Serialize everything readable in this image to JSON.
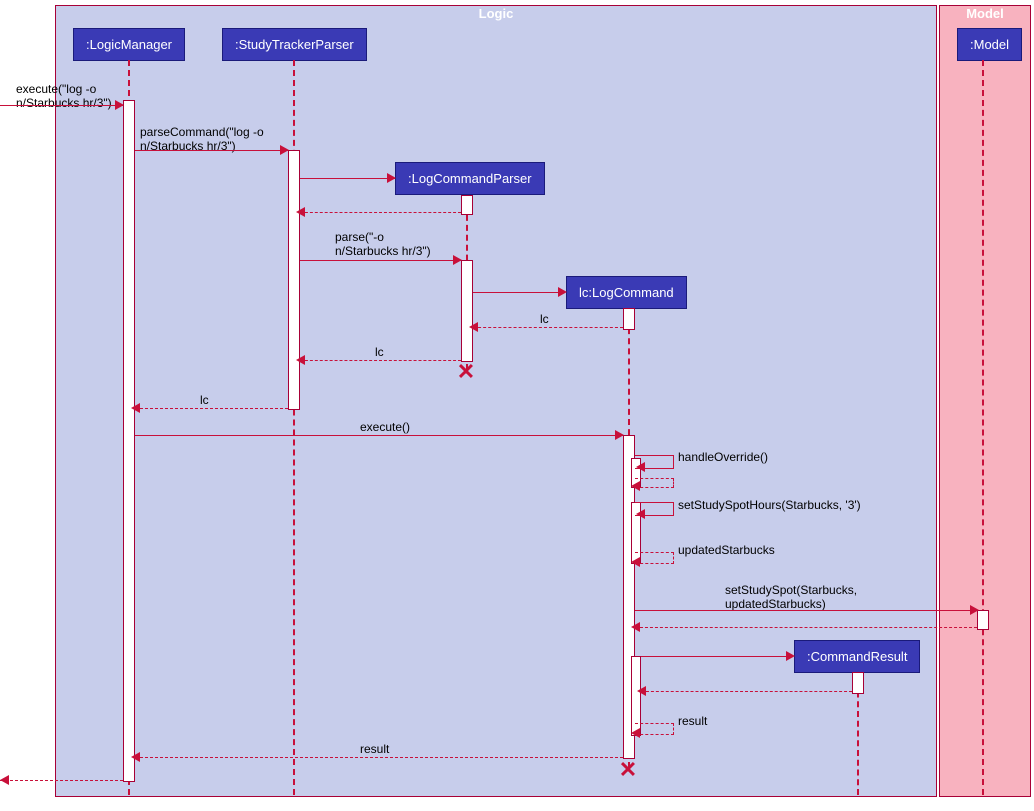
{
  "frames": {
    "logic": "Logic",
    "model": "Model"
  },
  "participants": {
    "logicManager": ":LogicManager",
    "studyTrackerParser": ":StudyTrackerParser",
    "logCommandParser": ":LogCommandParser",
    "logCommand": "lc:LogCommand",
    "commandResult": ":CommandResult",
    "model": ":Model"
  },
  "messages": {
    "execute1": "execute(\"log -o\nn/Starbucks hr/3\")",
    "parseCommand": "parseCommand(\"log -o\nn/Starbucks hr/3\")",
    "parse": "parse(\"-o\nn/Starbucks hr/3\")",
    "lc1": "lc",
    "lc2": "lc",
    "lc3": "lc",
    "execute2": "execute()",
    "handleOverride": "handleOverride()",
    "setStudySpotHours": "setStudySpotHours(Starbucks, '3')",
    "updatedStarbucks": "updatedStarbucks",
    "setStudySpot": "setStudySpot(Starbucks,\nupdatedStarbucks)",
    "result1": "result",
    "result2": "result"
  },
  "chart_data": {
    "type": "sequence-diagram",
    "frames": [
      {
        "name": "Logic",
        "participants": [
          "LogicManager",
          "StudyTrackerParser",
          "LogCommandParser",
          "lc:LogCommand",
          "CommandResult"
        ]
      },
      {
        "name": "Model",
        "participants": [
          "Model"
        ]
      }
    ],
    "participants": [
      {
        "id": "caller",
        "name": "(external)"
      },
      {
        "id": "LogicManager",
        "name": ":LogicManager"
      },
      {
        "id": "StudyTrackerParser",
        "name": ":StudyTrackerParser"
      },
      {
        "id": "LogCommandParser",
        "name": ":LogCommandParser",
        "created": true,
        "destroyed": true
      },
      {
        "id": "LogCommand",
        "name": "lc:LogCommand",
        "created": true,
        "destroyed": true
      },
      {
        "id": "CommandResult",
        "name": ":CommandResult",
        "created": true
      },
      {
        "id": "Model",
        "name": ":Model"
      }
    ],
    "messages": [
      {
        "from": "caller",
        "to": "LogicManager",
        "label": "execute(\"log -o n/Starbucks hr/3\")",
        "type": "sync"
      },
      {
        "from": "LogicManager",
        "to": "StudyTrackerParser",
        "label": "parseCommand(\"log -o n/Starbucks hr/3\")",
        "type": "sync"
      },
      {
        "from": "StudyTrackerParser",
        "to": "LogCommandParser",
        "label": "<<create>>",
        "type": "create"
      },
      {
        "from": "LogCommandParser",
        "to": "StudyTrackerParser",
        "label": "",
        "type": "return"
      },
      {
        "from": "StudyTrackerParser",
        "to": "LogCommandParser",
        "label": "parse(\"-o n/Starbucks hr/3\")",
        "type": "sync"
      },
      {
        "from": "LogCommandParser",
        "to": "LogCommand",
        "label": "<<create>>",
        "type": "create"
      },
      {
        "from": "LogCommand",
        "to": "LogCommandParser",
        "label": "lc",
        "type": "return"
      },
      {
        "from": "LogCommandParser",
        "to": "StudyTrackerParser",
        "label": "lc",
        "type": "return"
      },
      {
        "from": "LogCommandParser",
        "to": "LogCommandParser",
        "label": "",
        "type": "destroy"
      },
      {
        "from": "StudyTrackerParser",
        "to": "LogicManager",
        "label": "lc",
        "type": "return"
      },
      {
        "from": "LogicManager",
        "to": "LogCommand",
        "label": "execute()",
        "type": "sync"
      },
      {
        "from": "LogCommand",
        "to": "LogCommand",
        "label": "handleOverride()",
        "type": "self"
      },
      {
        "from": "LogCommand",
        "to": "LogCommand",
        "label": "setStudySpotHours(Starbucks, '3')",
        "type": "self"
      },
      {
        "from": "LogCommand",
        "to": "LogCommand",
        "label": "updatedStarbucks",
        "type": "self-return"
      },
      {
        "from": "LogCommand",
        "to": "Model",
        "label": "setStudySpot(Starbucks, updatedStarbucks)",
        "type": "sync"
      },
      {
        "from": "Model",
        "to": "LogCommand",
        "label": "",
        "type": "return"
      },
      {
        "from": "LogCommand",
        "to": "CommandResult",
        "label": "<<create>>",
        "type": "create"
      },
      {
        "from": "CommandResult",
        "to": "LogCommand",
        "label": "",
        "type": "return"
      },
      {
        "from": "LogCommand",
        "to": "LogCommand",
        "label": "result",
        "type": "self-return"
      },
      {
        "from": "LogCommand",
        "to": "LogicManager",
        "label": "result",
        "type": "return"
      },
      {
        "from": "LogCommand",
        "to": "LogCommand",
        "label": "",
        "type": "destroy"
      },
      {
        "from": "LogicManager",
        "to": "caller",
        "label": "",
        "type": "return"
      }
    ]
  }
}
